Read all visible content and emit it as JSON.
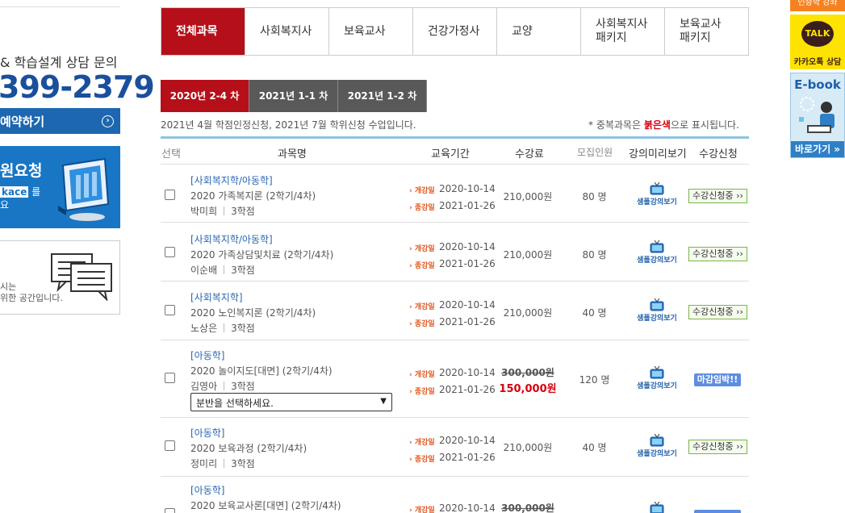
{
  "sidebar_left": {
    "consult_title": "& 학습설계 상담 문의",
    "phone": "399-2379",
    "reserve_label": "예약하기",
    "request_title": "원요청",
    "request_sub_pre": "kace",
    "request_sub_post": " 를",
    "request_sub2": "요",
    "community_t1": "시는",
    "community_t2": "위한 공간입니다."
  },
  "quick_menu": {
    "top_label": "인증학 강좌",
    "kakao_bubble": "TALK",
    "kakao_label": "카카오톡 상담",
    "ebook_title": "E-book",
    "ebook_go": "바로가기 »"
  },
  "category_tabs": [
    {
      "label": "전체과목",
      "active": true
    },
    {
      "label": "사회복지사",
      "active": false
    },
    {
      "label": "보육교사",
      "active": false
    },
    {
      "label": "건강가정사",
      "active": false
    },
    {
      "label": "교양",
      "active": false
    },
    {
      "label": "사회복지사\n패키지",
      "active": false
    },
    {
      "label": "보육교사\n패키지",
      "active": false
    }
  ],
  "semester_tabs": [
    {
      "label": "2020년 2-4 차",
      "active": true
    },
    {
      "label": "2021년 1-1 차",
      "active": false
    },
    {
      "label": "2021년 1-2 차",
      "active": false
    }
  ],
  "info": {
    "left": "2021년 4월 학점인정신청, 2021년 7월 학위신청 수업입니다.",
    "right_pre": "* 중복과목은 ",
    "right_red": "붉은색",
    "right_post": "으로 표시됩니다."
  },
  "table_headers": {
    "select": "선택",
    "course": "과목명",
    "period": "교육기간",
    "fee": "수강료",
    "capacity": "모집인원",
    "preview": "강의미리보기",
    "apply": "수강신청"
  },
  "labels": {
    "open_date": "› 개강일",
    "close_date": "› 종강일",
    "sample": "샘플강의보기",
    "apply_btn": "수강신청중 ››",
    "deadline_btn": "마감임박!!",
    "select_placeholder": "분반을 선택하세요."
  },
  "courses": [
    {
      "category": "[사회복지학/아동학]",
      "name": "2020 가족복지론 (2학기/4차)",
      "professor": "박미희",
      "credits": "3학점",
      "open": "2020-10-14",
      "close": "2021-01-26",
      "fee": "210,000원",
      "capacity": "80 명",
      "status": "apply"
    },
    {
      "category": "[사회복지학/아동학]",
      "name": "2020 가족상담및치료 (2학기/4차)",
      "professor": "이순배",
      "credits": "3학점",
      "open": "2020-10-14",
      "close": "2021-01-26",
      "fee": "210,000원",
      "capacity": "80 명",
      "status": "apply"
    },
    {
      "category": "[사회복지학]",
      "name": "2020 노인복지론 (2학기/4차)",
      "professor": "노상은",
      "credits": "3학점",
      "open": "2020-10-14",
      "close": "2021-01-26",
      "fee": "210,000원",
      "capacity": "40 명",
      "status": "apply"
    },
    {
      "category": "[아동학]",
      "name": "2020 놀이지도[대면] (2학기/4차)",
      "professor": "김영아",
      "credits": "3학점",
      "open": "2020-10-14",
      "close": "2021-01-26",
      "fee_old": "300,000원",
      "fee_new": "150,000원",
      "capacity": "120 명",
      "status": "deadline"
    },
    {
      "category": "[아동학]",
      "name": "2020 보육과정 (2학기/4차)",
      "professor": "정미리",
      "credits": "3학점",
      "open": "2020-10-14",
      "close": "2021-01-26",
      "fee": "210,000원",
      "capacity": "40 명",
      "status": "apply"
    },
    {
      "category": "[아동학]",
      "name": "2020 보육교사론[대면] (2학기/4차)",
      "open": "2020-10-14",
      "fee_old": "300,000원"
    }
  ]
}
